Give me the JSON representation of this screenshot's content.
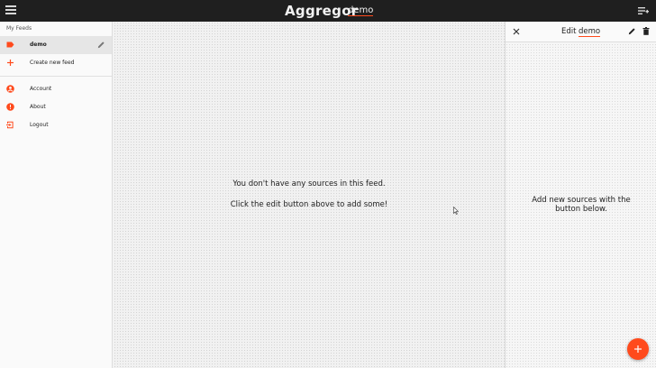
{
  "app": {
    "title": "Aggregor",
    "current_feed": "demo"
  },
  "colors": {
    "accent": "#ff4a1c",
    "topbar_bg": "#1f1f1f"
  },
  "sidebar": {
    "header": "My Feeds",
    "feeds": [
      {
        "label": "demo",
        "icon": "tag-icon",
        "active": true
      }
    ],
    "create_label": "Create new feed",
    "menu": [
      {
        "label": "Account",
        "icon": "account-icon"
      },
      {
        "label": "About",
        "icon": "info-icon"
      },
      {
        "label": "Logout",
        "icon": "logout-icon"
      }
    ]
  },
  "main": {
    "empty_line_1": "You don't have any sources in this feed.",
    "empty_line_2": "Click the edit button above to add some!"
  },
  "panel": {
    "title_prefix": "Edit",
    "feed_name": "demo",
    "message": "Add new sources with the button below."
  }
}
